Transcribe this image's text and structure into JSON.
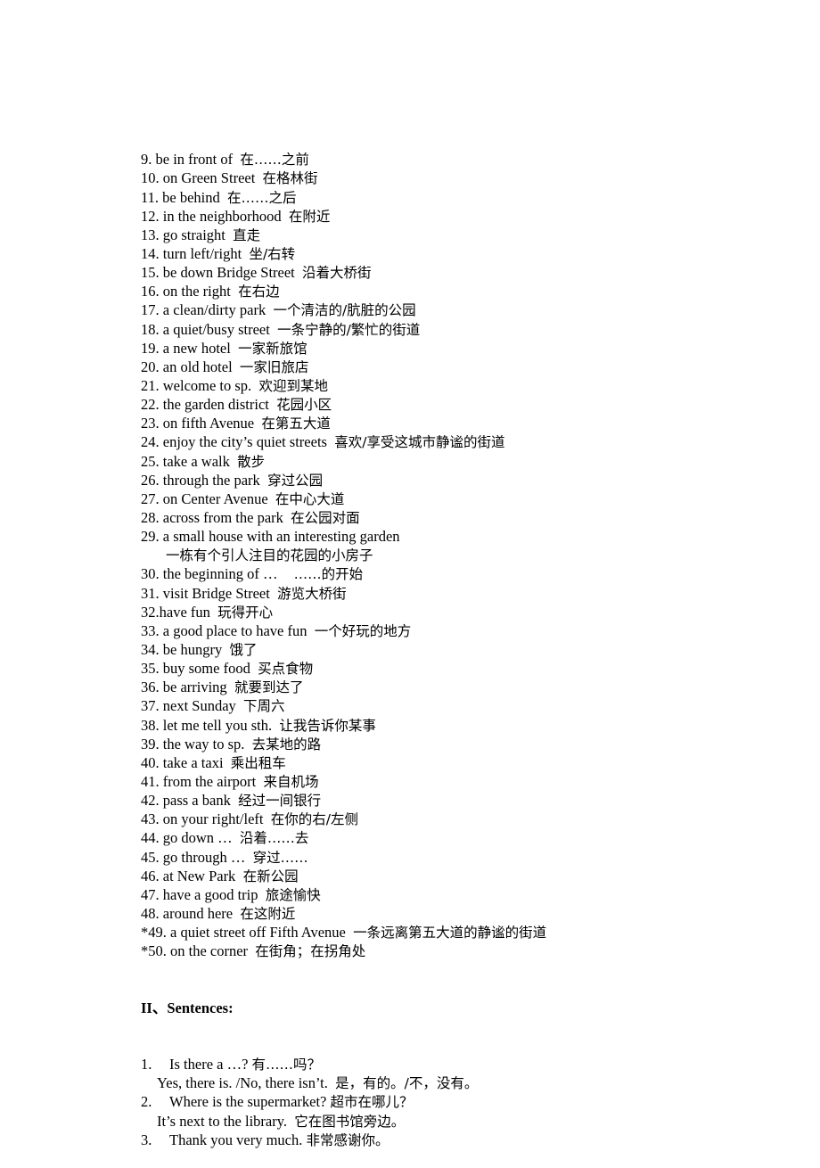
{
  "phrases": [
    {
      "num": "9. ",
      "en": "be in front of",
      "zh": "在……之前"
    },
    {
      "num": "10. ",
      "en": "on Green Street",
      "zh": "在格林街"
    },
    {
      "num": "11. ",
      "en": "be behind",
      "zh": "在……之后"
    },
    {
      "num": "12. ",
      "en": "in the neighborhood",
      "zh": "在附近"
    },
    {
      "num": "13. ",
      "en": "go straight",
      "zh": "直走"
    },
    {
      "num": "14. ",
      "en": "turn left/right",
      "zh": "坐/右转"
    },
    {
      "num": "15. ",
      "en": "be down Bridge Street",
      "zh": "沿着大桥街"
    },
    {
      "num": "16. ",
      "en": "on the right",
      "zh": "在右边"
    },
    {
      "num": "17. ",
      "en": "a clean/dirty park",
      "zh": "一个清洁的/肮脏的公园"
    },
    {
      "num": "18. ",
      "en": "a quiet/busy street",
      "zh": "一条宁静的/繁忙的街道"
    },
    {
      "num": "19. ",
      "en": "a new hotel",
      "zh": "一家新旅馆"
    },
    {
      "num": "20. ",
      "en": "an old hotel",
      "zh": "一家旧旅店"
    },
    {
      "num": "21. ",
      "en": "welcome to sp.",
      "zh": "欢迎到某地"
    },
    {
      "num": "22. ",
      "en": "the garden district",
      "zh": "花园小区"
    },
    {
      "num": "23. ",
      "en": "on fifth Avenue",
      "zh": "在第五大道"
    },
    {
      "num": "24. ",
      "en": "enjoy the city’s quiet streets",
      "zh": "喜欢/享受这城市静谧的街道"
    },
    {
      "num": "25. ",
      "en": "take a walk",
      "zh": "散步"
    },
    {
      "num": "26. ",
      "en": "through the park",
      "zh": "穿过公园"
    },
    {
      "num": "27. ",
      "en": "on Center Avenue",
      "zh": "在中心大道"
    },
    {
      "num": "28. ",
      "en": "across from the park",
      "zh": "在公园对面"
    },
    {
      "num": "29. ",
      "en": "a small house with an interesting garden",
      "zh": "一栋有个引人注目的花园的小房子",
      "zh_on_next_line": true
    },
    {
      "num": "30. ",
      "en": "the beginning of …",
      "zh": "  ……的开始"
    },
    {
      "num": "31. ",
      "en": "visit Bridge Street",
      "zh": "游览大桥街"
    },
    {
      "num": "32.",
      "en": "have fun",
      "zh": "玩得开心"
    },
    {
      "num": "33. ",
      "en": "a good place to have fun",
      "zh": "一个好玩的地方"
    },
    {
      "num": "34. ",
      "en": "be hungry",
      "zh": "饿了"
    },
    {
      "num": "35. ",
      "en": "buy some food",
      "zh": "买点食物"
    },
    {
      "num": "36. ",
      "en": "be arriving",
      "zh": "就要到达了"
    },
    {
      "num": "37. ",
      "en": "next Sunday",
      "zh": "下周六"
    },
    {
      "num": "38. ",
      "en": "let me tell you sth.",
      "zh": "让我告诉你某事"
    },
    {
      "num": "39. ",
      "en": "the way to sp.",
      "zh": "去某地的路"
    },
    {
      "num": "40. ",
      "en": "take a taxi",
      "zh": "乘出租车"
    },
    {
      "num": "41. ",
      "en": "from the airport",
      "zh": "来自机场"
    },
    {
      "num": "42. ",
      "en": "pass a bank",
      "zh": "经过一间银行"
    },
    {
      "num": "43. ",
      "en": "on your right/left",
      "zh": "在你的右/左侧"
    },
    {
      "num": "44. ",
      "en": "go down …",
      "zh": "沿着……去"
    },
    {
      "num": "45. ",
      "en": "go through …",
      "zh": "穿过……"
    },
    {
      "num": "46. ",
      "en": "at New Park",
      "zh": "在新公园"
    },
    {
      "num": "47. ",
      "en": "have a good trip",
      "zh": "旅途愉快"
    },
    {
      "num": "48. ",
      "en": "around here",
      "zh": "在这附近"
    },
    {
      "num": "*49. ",
      "en": "a quiet street off Fifth Avenue",
      "zh": "一条远离第五大道的静谧的街道"
    },
    {
      "num": "*50. ",
      "en": "on the corner",
      "zh": "在街角；在拐角处"
    }
  ],
  "sentences_heading": "II、Sentences:",
  "sentences": [
    {
      "num": "1.",
      "en": "Is there a …?",
      "zh": "有……吗？",
      "answer_en": "Yes, there is. /No, there isn’t.",
      "answer_zh": "是，有的。/不，没有。"
    },
    {
      "num": "2.",
      "en": "Where is the supermarket?",
      "zh": "超市在哪儿？",
      "answer_en": "It’s next to the library.",
      "answer_zh": "它在图书馆旁边。"
    },
    {
      "num": "3.",
      "en": "Thank you very much.",
      "zh": "非常感谢你。"
    }
  ]
}
